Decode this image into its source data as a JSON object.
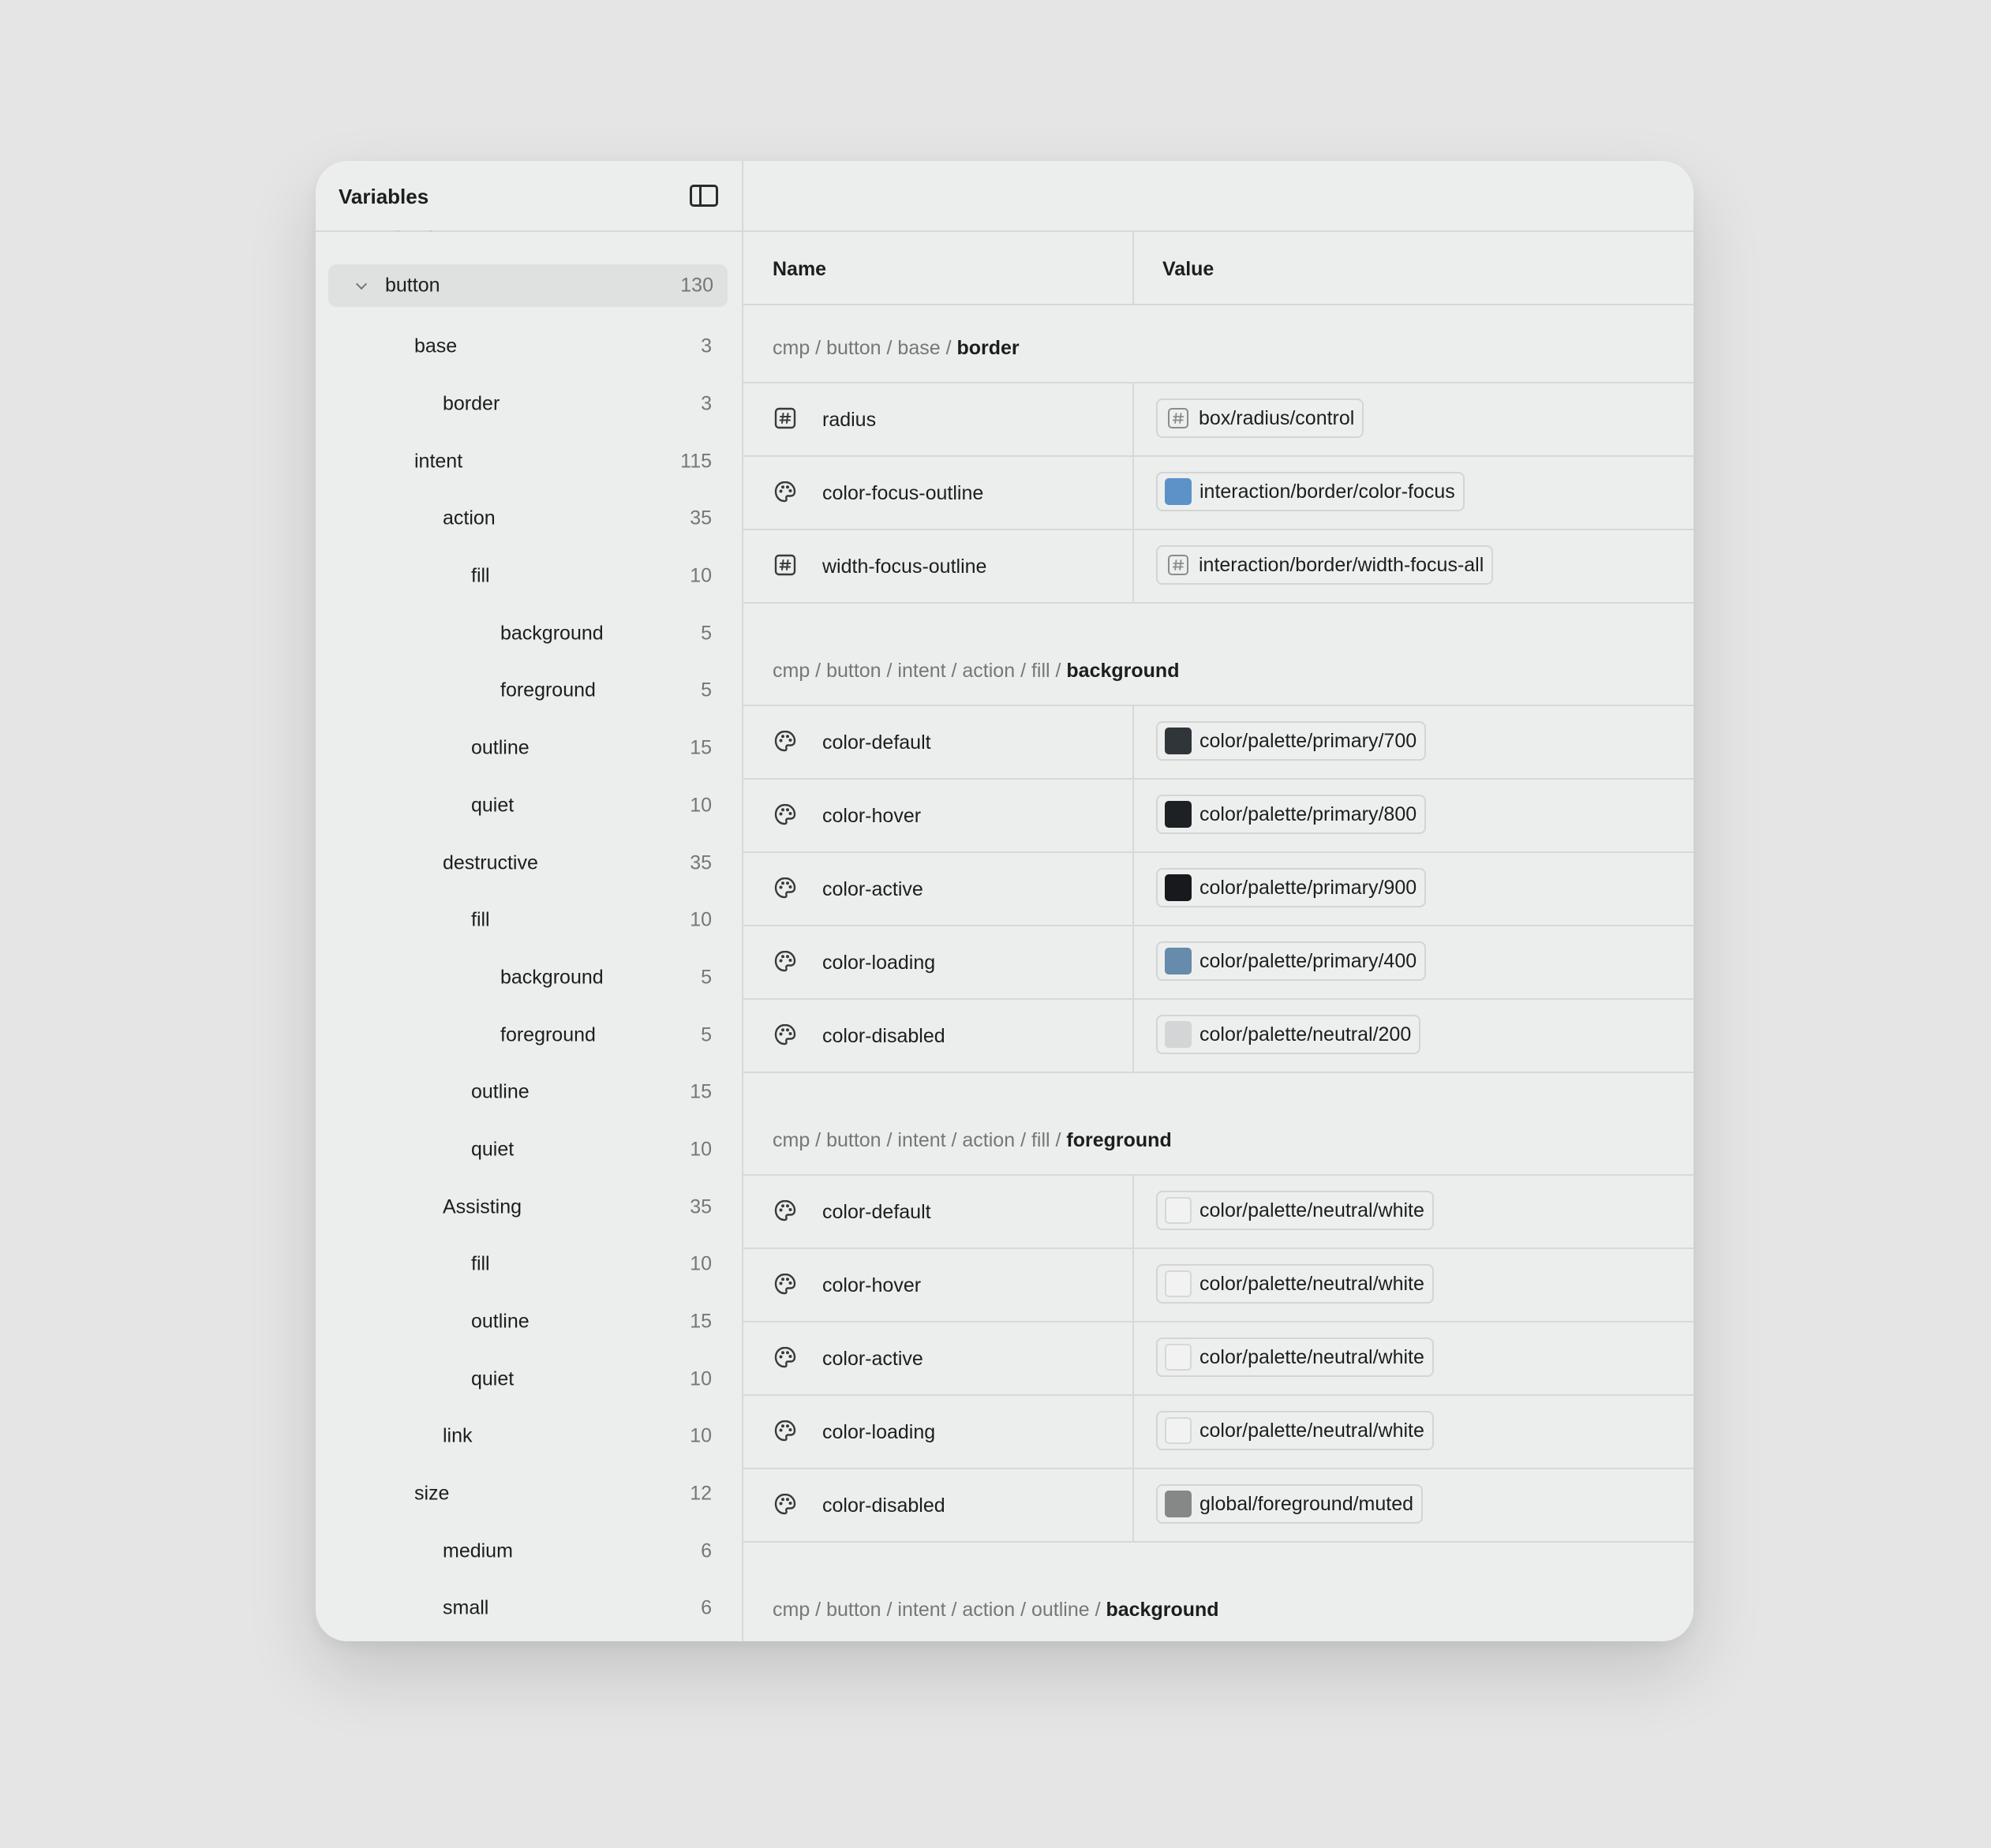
{
  "sidebar": {
    "title": "Variables",
    "items": [
      {
        "label": "button",
        "count": "130",
        "depth": 0,
        "selected": true
      },
      {
        "label": "base",
        "count": "3",
        "depth": 1
      },
      {
        "label": "border",
        "count": "3",
        "depth": 2
      },
      {
        "label": "intent",
        "count": "115",
        "depth": 1
      },
      {
        "label": "action",
        "count": "35",
        "depth": 2
      },
      {
        "label": "fill",
        "count": "10",
        "depth": 3
      },
      {
        "label": "background",
        "count": "5",
        "depth": 4
      },
      {
        "label": "foreground",
        "count": "5",
        "depth": 4
      },
      {
        "label": "outline",
        "count": "15",
        "depth": 3
      },
      {
        "label": "quiet",
        "count": "10",
        "depth": 3
      },
      {
        "label": "destructive",
        "count": "35",
        "depth": 2
      },
      {
        "label": "fill",
        "count": "10",
        "depth": 3
      },
      {
        "label": "background",
        "count": "5",
        "depth": 4
      },
      {
        "label": "foreground",
        "count": "5",
        "depth": 4
      },
      {
        "label": "outline",
        "count": "15",
        "depth": 3
      },
      {
        "label": "quiet",
        "count": "10",
        "depth": 3
      },
      {
        "label": "Assisting",
        "count": "35",
        "depth": 2
      },
      {
        "label": "fill",
        "count": "10",
        "depth": 3
      },
      {
        "label": "outline",
        "count": "15",
        "depth": 3
      },
      {
        "label": "quiet",
        "count": "10",
        "depth": 3
      },
      {
        "label": "link",
        "count": "10",
        "depth": 2
      },
      {
        "label": "size",
        "count": "12",
        "depth": 1
      },
      {
        "label": "medium",
        "count": "6",
        "depth": 2
      },
      {
        "label": "small",
        "count": "6",
        "depth": 2
      }
    ]
  },
  "table": {
    "name_header": "Name",
    "value_header": "Value",
    "groups": [
      {
        "path": "cmp / button / base / ",
        "leaf": "border",
        "rows": [
          {
            "icon": "number-icon",
            "name": "radius",
            "value": "box/radius/control",
            "value_icon": "number-icon",
            "swatch": null
          },
          {
            "icon": "palette-icon",
            "name": "color-focus-outline",
            "value": "interaction/border/color-focus",
            "value_icon": "color-swatch",
            "swatch": "#5b93c9"
          },
          {
            "icon": "number-icon",
            "name": "width-focus-outline",
            "value": "interaction/border/width-focus-all",
            "value_icon": "number-icon",
            "swatch": null
          }
        ]
      },
      {
        "path": "cmp / button / intent / action / fill / ",
        "leaf": "background",
        "rows": [
          {
            "icon": "palette-icon",
            "name": "color-default",
            "value": "color/palette/primary/700",
            "value_icon": "color-swatch",
            "swatch": "#2f3538"
          },
          {
            "icon": "palette-icon",
            "name": "color-hover",
            "value": "color/palette/primary/800",
            "value_icon": "color-swatch",
            "swatch": "#1e2124"
          },
          {
            "icon": "palette-icon",
            "name": "color-active",
            "value": "color/palette/primary/900",
            "value_icon": "color-swatch",
            "swatch": "#18191c"
          },
          {
            "icon": "palette-icon",
            "name": "color-loading",
            "value": "color/palette/primary/400",
            "value_icon": "color-swatch",
            "swatch": "#668bab"
          },
          {
            "icon": "palette-icon",
            "name": "color-disabled",
            "value": "color/palette/neutral/200",
            "value_icon": "color-swatch",
            "swatch": "#d3d5d6"
          }
        ]
      },
      {
        "path": "cmp / button / intent / action / fill / ",
        "leaf": "foreground",
        "rows": [
          {
            "icon": "palette-icon",
            "name": "color-default",
            "value": "color/palette/neutral/white",
            "value_icon": "color-swatch",
            "swatch": "#f1f2f1"
          },
          {
            "icon": "palette-icon",
            "name": "color-hover",
            "value": "color/palette/neutral/white",
            "value_icon": "color-swatch",
            "swatch": "#f1f2f1"
          },
          {
            "icon": "palette-icon",
            "name": "color-active",
            "value": "color/palette/neutral/white",
            "value_icon": "color-swatch",
            "swatch": "#f1f2f1"
          },
          {
            "icon": "palette-icon",
            "name": "color-loading",
            "value": "color/palette/neutral/white",
            "value_icon": "color-swatch",
            "swatch": "#f1f2f1"
          },
          {
            "icon": "palette-icon",
            "name": "color-disabled",
            "value": "global/foreground/muted",
            "value_icon": "color-swatch",
            "swatch": "#868887"
          }
        ]
      },
      {
        "path": "cmp / button / intent / action / outline / ",
        "leaf": "background",
        "rows": []
      }
    ]
  }
}
